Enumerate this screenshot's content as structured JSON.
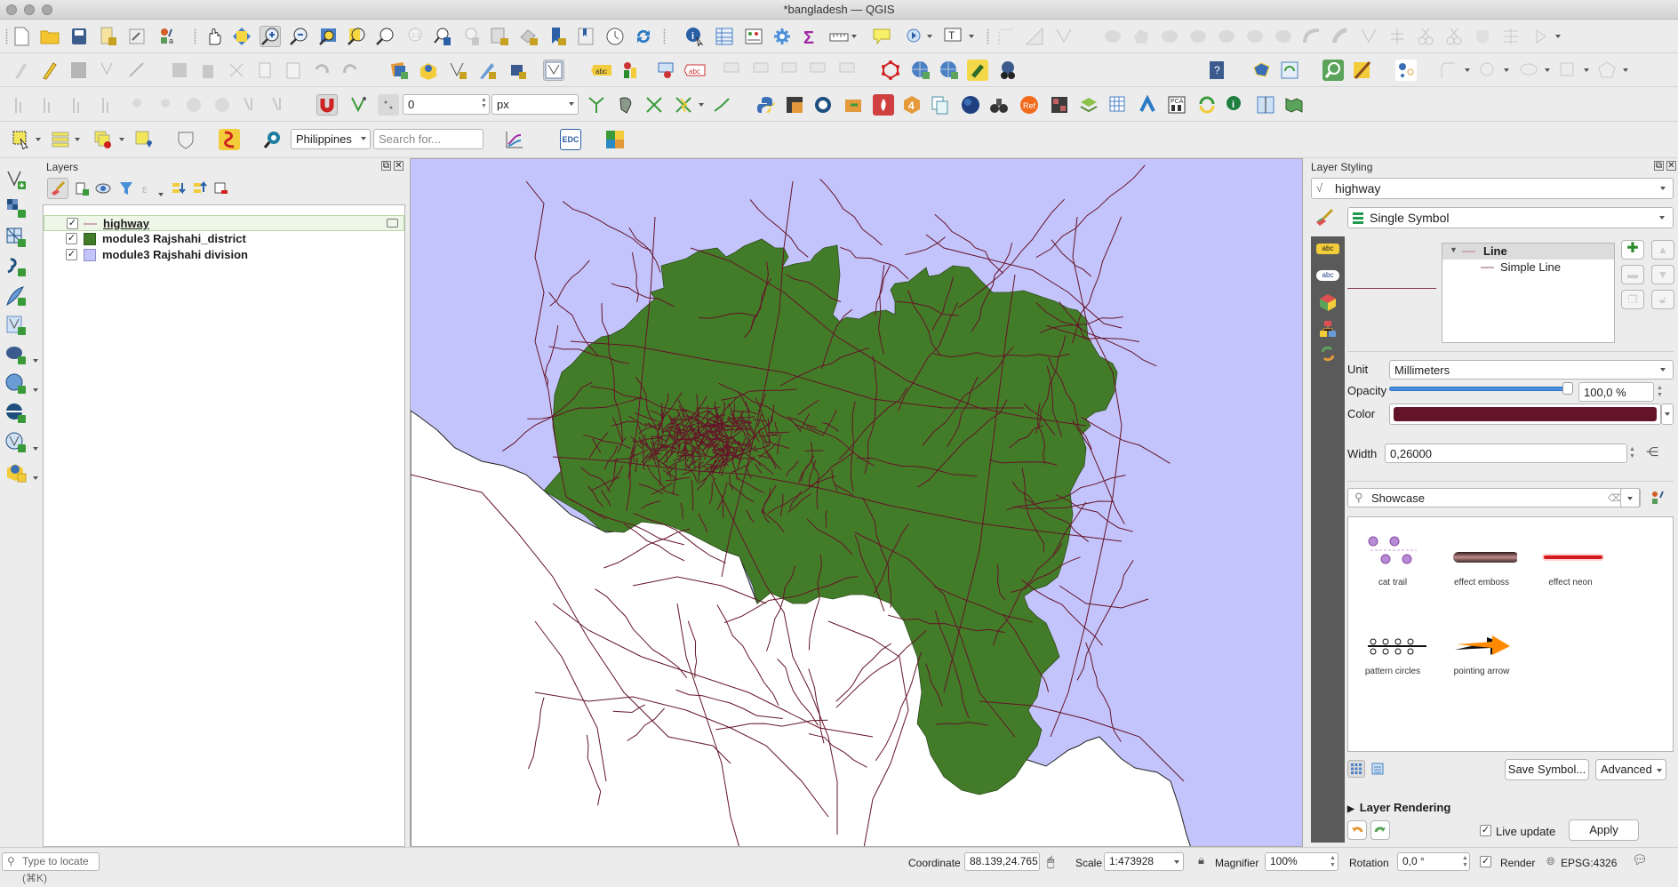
{
  "window": {
    "title": "*bangladesh — QGIS"
  },
  "toolbar": {
    "snapping_tolerance": "0",
    "snapping_unit": "px",
    "locator_country": "Philippines",
    "search_placeholder": "Search for...",
    "edc_label": "EDC"
  },
  "layers_panel": {
    "title": "Layers",
    "layers": [
      {
        "name": "highway",
        "checked": true,
        "symbol": "line",
        "color": "#c9a9b4",
        "selected": true
      },
      {
        "name": "module3 Rajshahi_district",
        "checked": true,
        "symbol": "fill",
        "color": "#437c28"
      },
      {
        "name": "module3 Rajshahi division",
        "checked": true,
        "symbol": "fill",
        "color": "#c4c4fc"
      }
    ]
  },
  "map": {
    "colors": {
      "division_fill": "#c4c4fc",
      "district_fill": "#437c28",
      "highway": "#641428",
      "outside": "#ffffff"
    }
  },
  "styling_panel": {
    "title": "Layer Styling",
    "layer": "highway",
    "renderer": "Single Symbol",
    "symbol_tree": {
      "root": "Line",
      "child": "Simple Line"
    },
    "unit_label": "Unit",
    "unit_value": "Millimeters",
    "opacity_label": "Opacity",
    "opacity_value": "100,0 %",
    "opacity_fraction": 1.0,
    "color_label": "Color",
    "color_value": "#641428",
    "width_label": "Width",
    "width_value": "0,26000",
    "library_search": "Showcase",
    "symbols": [
      {
        "name": "cat trail"
      },
      {
        "name": "effect emboss"
      },
      {
        "name": "effect neon"
      },
      {
        "name": "pattern circles"
      },
      {
        "name": "pointing arrow"
      }
    ],
    "save_symbol_label": "Save Symbol...",
    "advanced_label": "Advanced",
    "layer_rendering_label": "Layer Rendering",
    "live_update_label": "Live update",
    "live_update_checked": true,
    "apply_label": "Apply"
  },
  "statusbar": {
    "locator_placeholder": "Type to locate (⌘K)",
    "coordinate_label": "Coordinate",
    "coordinate_value": "88.139,24.765",
    "scale_label": "Scale",
    "scale_value": "1:473928",
    "magnifier_label": "Magnifier",
    "magnifier_value": "100%",
    "rotation_label": "Rotation",
    "rotation_value": "0,0 °",
    "render_label": "Render",
    "render_checked": true,
    "crs": "EPSG:4326"
  }
}
